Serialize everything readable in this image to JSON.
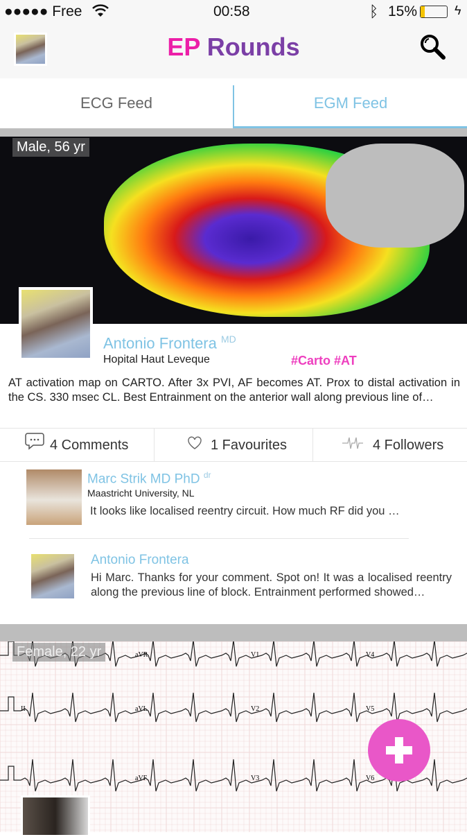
{
  "status_bar": {
    "carrier": "●●●●● Free",
    "time": "00:58",
    "battery": "15%",
    "battery_level": 0.15
  },
  "nav": {
    "title_part1": "EP",
    "title_part2": " Rounds",
    "title_color1": "#ec1fa8",
    "title_color2": "#7b3fa6",
    "search_icon": "magnifier"
  },
  "tabs": [
    {
      "label": "ECG Feed",
      "active": false
    },
    {
      "label": "EGM Feed",
      "active": true
    }
  ],
  "accent": "#7fc3e4",
  "post": {
    "patient": "Male, 56 yr",
    "author": "Antonio Frontera",
    "author_suffix": "MD",
    "hospital": "Hopital Haut Leveque",
    "tags": "#Carto #AT",
    "description": "AT activation map on CARTO. After 3x PVI, AF becomes AT. Prox to distal activation in the CS. 330 msec CL. Best Entrainment on the anterior wall along previous line of…",
    "actions": {
      "comments": "4 Comments",
      "favourites": "1 Favourites",
      "followers": "4 Followers"
    },
    "comments": [
      {
        "name": "Marc Strik MD PhD",
        "suffix": "dr",
        "affiliation": "Maastricht University, NL",
        "text": "It looks like localised reentry circuit. How much RF did you …"
      },
      {
        "name": "Antonio Frontera",
        "text": "Hi Marc. Thanks for your comment. Spot on! It was a localised reentry along the previous line of block. Entrainment performed showed…"
      }
    ]
  },
  "post2": {
    "patient": "Female, 22 yr",
    "ecg_leads": [
      "aVR",
      "V1",
      "V4",
      "II",
      "aVL",
      "V2",
      "V5",
      "aVF",
      "V3",
      "V6"
    ]
  },
  "fab": {
    "icon": "plus",
    "color": "#e957c8"
  }
}
